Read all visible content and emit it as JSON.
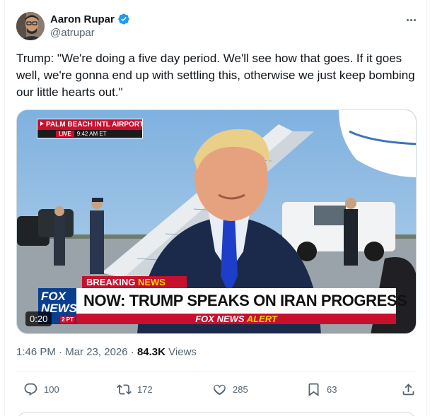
{
  "author": {
    "name": "Aaron Rupar",
    "handle": "@atrupar",
    "verified": true
  },
  "post": {
    "text": "Trump: \"We're doing a five day period. We'll see how that goes. If it goes well, we're gonna end up with settling this, otherwise we just keep bombing our little hearts out.\"",
    "time": "1:46 PM",
    "date": "Mar 23, 2026",
    "separator": "·",
    "views_count": "84.3K",
    "views_label": "Views"
  },
  "video": {
    "duration": "0:20",
    "location_banner": "PALM BEACH INTL AIRPORT",
    "live_label": "LIVE",
    "live_time": "9:42 AM ET",
    "breaking_prefix": "BREAKING",
    "breaking_suffix": "NEWS",
    "headline": "NOW: TRUMP SPEAKS ON IRAN PROGRESS",
    "alert_prefix": "FOX NEWS",
    "alert_suffix": "ALERT",
    "logo_text_1": "FOX",
    "logo_text_2": "NEWS",
    "logo_pt": "2 PT"
  },
  "actions": {
    "replies": "100",
    "reposts": "172",
    "likes": "285",
    "bookmarks": "63"
  },
  "icons": {
    "verified": "verified-badge-icon",
    "more": "more-icon",
    "reply": "reply-icon",
    "repost": "repost-icon",
    "like": "heart-icon",
    "bookmark": "bookmark-icon",
    "share": "share-icon"
  },
  "colors": {
    "verified_blue": "#1d9bf0",
    "text_primary": "#0f1419",
    "text_secondary": "#536471",
    "fox_red": "#c8102e",
    "fox_blue": "#0a3f8f"
  }
}
